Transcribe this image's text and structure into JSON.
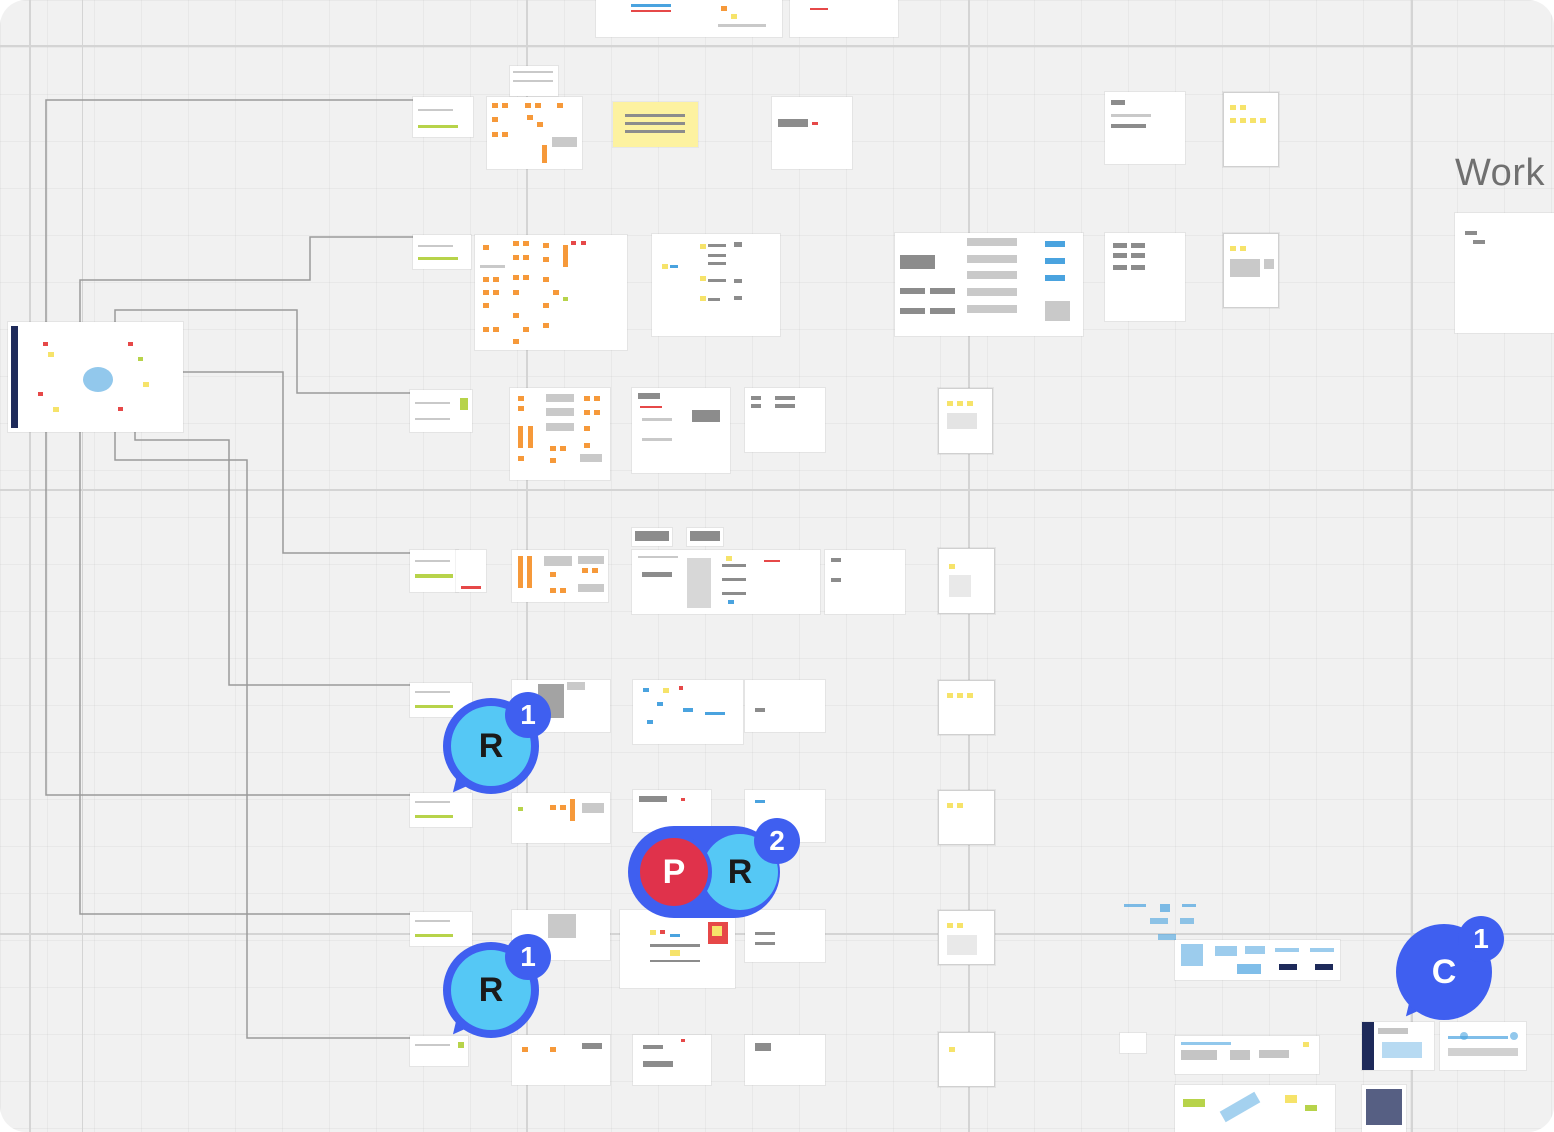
{
  "board": {
    "section_title": "Work",
    "colors": {
      "canvas": "#f1f1f1",
      "frame": "#ffffff",
      "sticky": "#fdf2a0",
      "orange": "#f6993a",
      "collaborator_light_blue": "#55c8f5",
      "collaborator_blue": "#3f5ff0",
      "collaborator_red": "#e0324b"
    }
  },
  "collaborators": [
    {
      "id": "r1",
      "initials": [
        "R"
      ],
      "count": "1"
    },
    {
      "id": "pr",
      "initials": [
        "P",
        "R"
      ],
      "count": "2"
    },
    {
      "id": "r2",
      "initials": [
        "R"
      ],
      "count": "1"
    },
    {
      "id": "c1",
      "initials": [
        "C"
      ],
      "count": "1"
    }
  ]
}
